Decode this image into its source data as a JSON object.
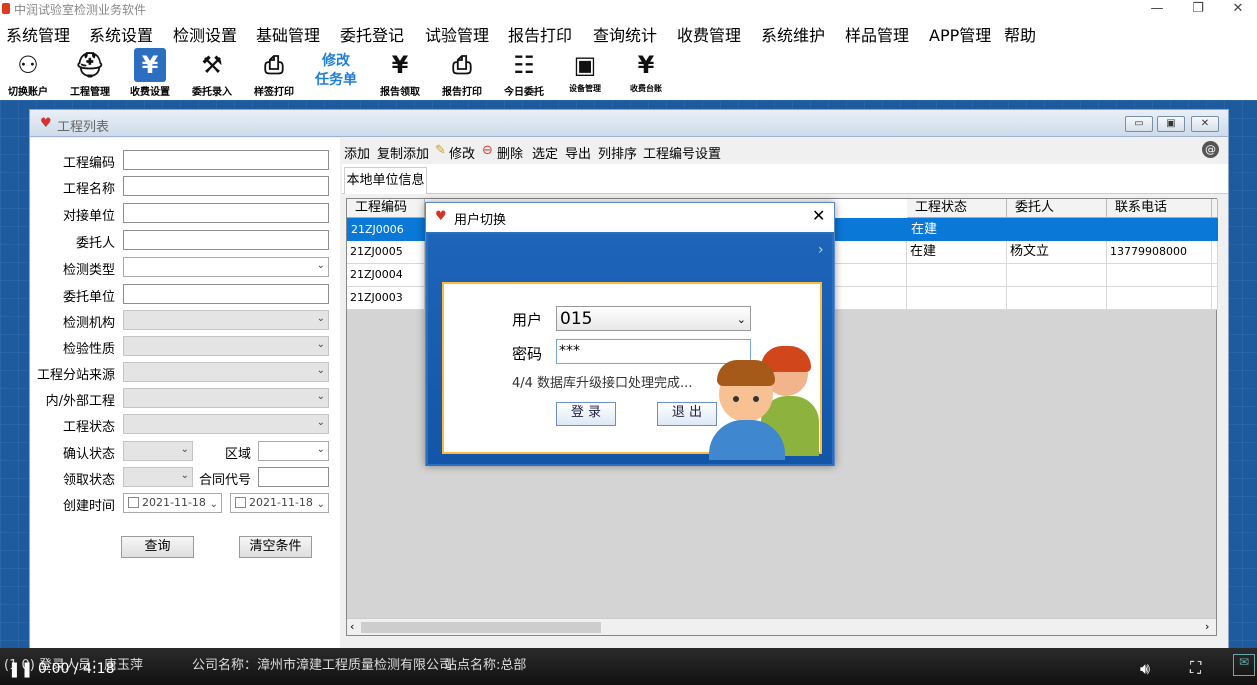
{
  "app": {
    "title": "中润试验室检测业务软件"
  },
  "menu": [
    "系统管理",
    "系统设置",
    "检测设置",
    "基础管理",
    "委托登记",
    "试验管理",
    "报告打印",
    "查询统计",
    "收费管理",
    "系统维护",
    "样品管理",
    "APP管理",
    "帮助"
  ],
  "toolbar": [
    {
      "label": "切换账户",
      "icon": "switch-user-icon"
    },
    {
      "label": "工程管理",
      "icon": "hardhat-icon"
    },
    {
      "label": "收费设置",
      "icon": "yen-board-icon"
    },
    {
      "label": "委托录入",
      "icon": "stamp-icon"
    },
    {
      "label": "样签打印",
      "icon": "label-printer-icon"
    },
    {
      "label": "修改\n任务单",
      "icon": "edit-task-text"
    },
    {
      "label": "报告领取",
      "icon": "report-yen-icon"
    },
    {
      "label": "报告打印",
      "icon": "printer-icon"
    },
    {
      "label": "今日委托",
      "icon": "today-doc-icon"
    },
    {
      "label": "设备管理",
      "icon": "device-icon"
    },
    {
      "label": "收费台账",
      "icon": "ledger-yen-icon"
    }
  ],
  "window": {
    "title": "工程列表"
  },
  "form": {
    "fields": [
      {
        "label": "工程编码",
        "type": "input",
        "value": ""
      },
      {
        "label": "工程名称",
        "type": "input",
        "value": ""
      },
      {
        "label": "对接单位",
        "type": "input",
        "value": ""
      },
      {
        "label": "委托人",
        "type": "input",
        "value": ""
      },
      {
        "label": "检测类型",
        "type": "select",
        "value": ""
      },
      {
        "label": "委托单位",
        "type": "input",
        "value": ""
      },
      {
        "label": "检测机构",
        "type": "select",
        "value": "",
        "disabled": true
      },
      {
        "label": "检验性质",
        "type": "select",
        "value": "",
        "disabled": true
      },
      {
        "label": "工程分站来源",
        "type": "select",
        "value": "",
        "disabled": true
      },
      {
        "label": "内/外部工程",
        "type": "select",
        "value": "",
        "disabled": true
      },
      {
        "label": "工程状态",
        "type": "select",
        "value": "",
        "disabled": true
      }
    ],
    "confirm_label": "确认状态",
    "region_label": "区域",
    "receive_label": "领取状态",
    "contract_label": "合同代号",
    "created_label": "创建时间",
    "date_from": "2021-11-18",
    "date_to": "2021-11-18",
    "query_button": "查询",
    "clear_button": "清空条件"
  },
  "actions": {
    "add": "添加",
    "copy_add": "复制添加",
    "edit": "修改",
    "delete": "删除",
    "select": "选定",
    "export": "导出",
    "sort": "列排序",
    "code_settings": "工程编号设置"
  },
  "tab": "本地单位信息",
  "table": {
    "columns": [
      "工程编码",
      "工程状态",
      "委托人",
      "联系电话"
    ],
    "rows": [
      {
        "code": "21ZJ0006",
        "status": "在建",
        "client": "",
        "phone": ""
      },
      {
        "code": "21ZJ0005",
        "status": "在建",
        "client": "杨文立",
        "phone": "13779908000"
      },
      {
        "code": "21ZJ0004",
        "status": "",
        "client": "",
        "phone": ""
      },
      {
        "code": "21ZJ0003",
        "status": "",
        "client": "",
        "phone": ""
      }
    ]
  },
  "dialog": {
    "title": "用户切换",
    "user_label": "用户",
    "user_value": "015",
    "pwd_label": "密码",
    "pwd_value": "***",
    "status": "4/4 数据库升级接口处理完成...",
    "login_button": "登 录",
    "exit_button": "退 出"
  },
  "status": {
    "user": "(1 0) 登录人员：唐玉萍",
    "company": "公司名称：漳州市漳建工程质量检测有限公司",
    "site": "站点名称:总部",
    "time": "0:00 / 4:18"
  }
}
